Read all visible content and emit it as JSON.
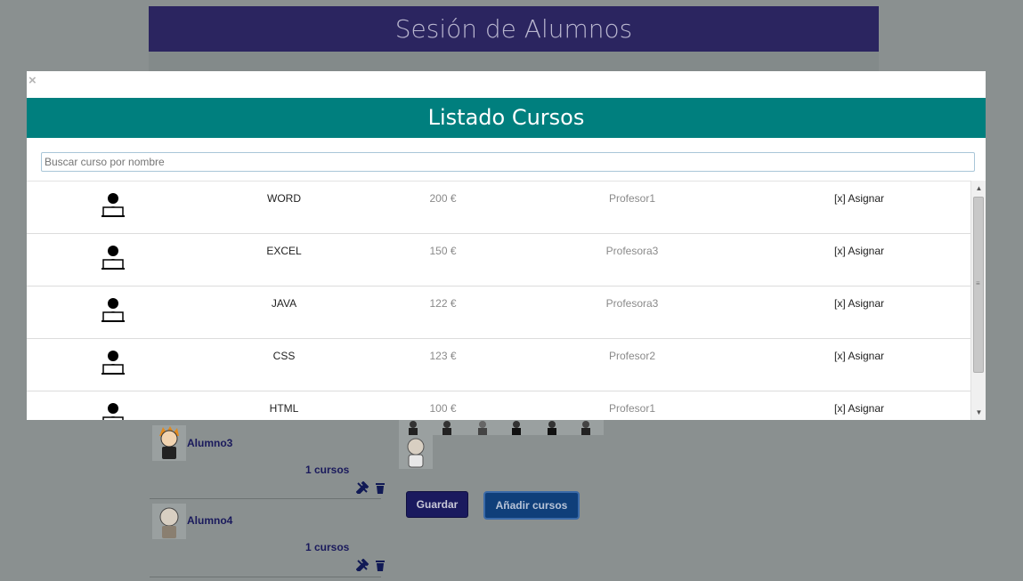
{
  "page": {
    "header_title": "Sesión de Alumnos",
    "students": [
      {
        "name": "Alumno3",
        "courses": "1 cursos"
      },
      {
        "name": "Alumno4",
        "courses": "1 cursos"
      }
    ],
    "buttons": {
      "save": "Guardar",
      "add_courses": "Añadir cursos"
    }
  },
  "modal": {
    "close_glyph": "×",
    "title": "Listado Cursos",
    "search_placeholder": "Buscar curso por nombre",
    "assign_label": "[x] Asignar",
    "courses": [
      {
        "name": "WORD",
        "price": "200 €",
        "teacher": "Profesor1"
      },
      {
        "name": "EXCEL",
        "price": "150 €",
        "teacher": "Profesora3"
      },
      {
        "name": "JAVA",
        "price": "122 €",
        "teacher": "Profesora3"
      },
      {
        "name": "CSS",
        "price": "123 €",
        "teacher": "Profesor2"
      },
      {
        "name": "HTML",
        "price": "100 €",
        "teacher": "Profesor1"
      }
    ]
  },
  "colors": {
    "header_bg": "#2b2560",
    "modal_title_bg": "#007f7e",
    "overlay_bg": "#8a9090",
    "save_button_bg": "#1a1a5e",
    "add_button_bg": "#0f3f7a"
  },
  "icons": {
    "course": "teacher-laptop-icon",
    "close": "close-icon",
    "edit": "tools-icon",
    "delete": "trash-icon"
  }
}
